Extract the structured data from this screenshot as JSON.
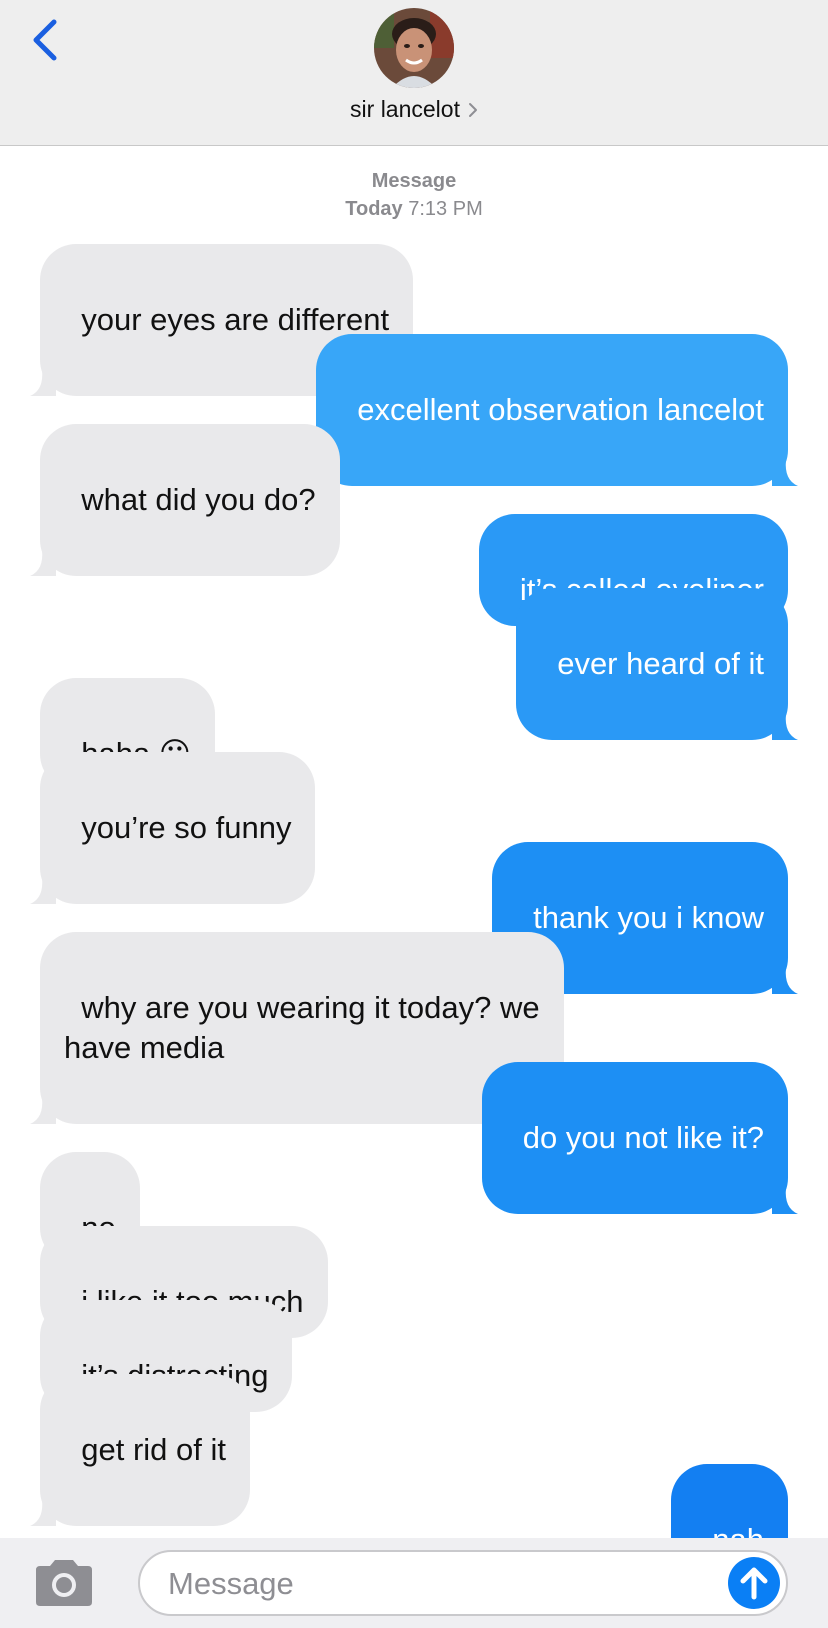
{
  "header": {
    "contact_name": "sir lancelot",
    "back_icon": "chevron-left-icon",
    "accent_color": "#1a5fe0"
  },
  "meta": {
    "service": "Message",
    "day": "Today",
    "time": "7:13 PM"
  },
  "messages": [
    {
      "from": "them",
      "text": "your eyes are different"
    },
    {
      "from": "me",
      "text": "excellent observation lancelot"
    },
    {
      "from": "them",
      "text": "what did you do?"
    },
    {
      "from": "me",
      "text": "it’s called eyeliner"
    },
    {
      "from": "me",
      "text": "ever heard of it"
    },
    {
      "from": "them",
      "text": "haha 😐"
    },
    {
      "from": "them",
      "text": "you’re so funny"
    },
    {
      "from": "me",
      "text": "thank you i know"
    },
    {
      "from": "them",
      "text": "why are you wearing it today? we\nhave media"
    },
    {
      "from": "me",
      "text": "do you not like it?"
    },
    {
      "from": "them",
      "text": "no"
    },
    {
      "from": "them",
      "text": "i like it too much"
    },
    {
      "from": "them",
      "text": "it’s distracting"
    },
    {
      "from": "them",
      "text": "get rid of it"
    },
    {
      "from": "me",
      "text": "nah"
    }
  ],
  "composer": {
    "placeholder": "Message",
    "camera_icon": "camera-icon",
    "send_icon": "arrow-up-icon",
    "send_color": "#0a7ff5"
  },
  "colors": {
    "sent_bubble": "#1d8ff4",
    "received_bubble": "#e9e9eb"
  }
}
